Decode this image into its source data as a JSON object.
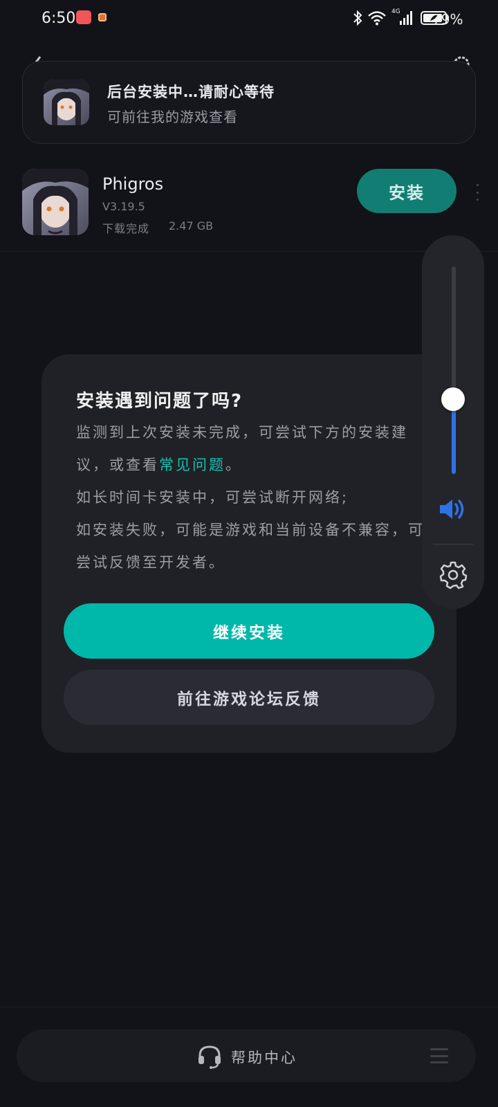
{
  "status_bar": {
    "time": "6:50",
    "network": "4G",
    "battery": "79%"
  },
  "toast": {
    "title": "后台安装中…请耐心等待",
    "subtitle": "可前往我的游戏查看"
  },
  "game": {
    "name": "Phigros",
    "version": "V3.19.5",
    "status": "下载完成",
    "size": "2.47 GB",
    "install_label": "安装"
  },
  "dialog": {
    "title": "安装遇到问题了吗?",
    "line1_before": "监测到上次安装未完成，可尝试下方的安装建议，或查看",
    "faq_link": "常见问题",
    "line1_after": "。",
    "line2": "如长时间卡安装中，可尝试断开网络;",
    "line3": "如安装失败，可能是游戏和当前设备不兼容，可尝试反馈至开发者。",
    "continue_label": "继续安装",
    "forum_label": "前往游戏论坛反馈"
  },
  "volume": {
    "level": 0.36,
    "accent": "#2f72e8"
  },
  "bottom": {
    "help_label": "帮助中心"
  },
  "colors": {
    "accent": "#00b8a9",
    "link": "#15c2b0",
    "background": "#111318"
  }
}
